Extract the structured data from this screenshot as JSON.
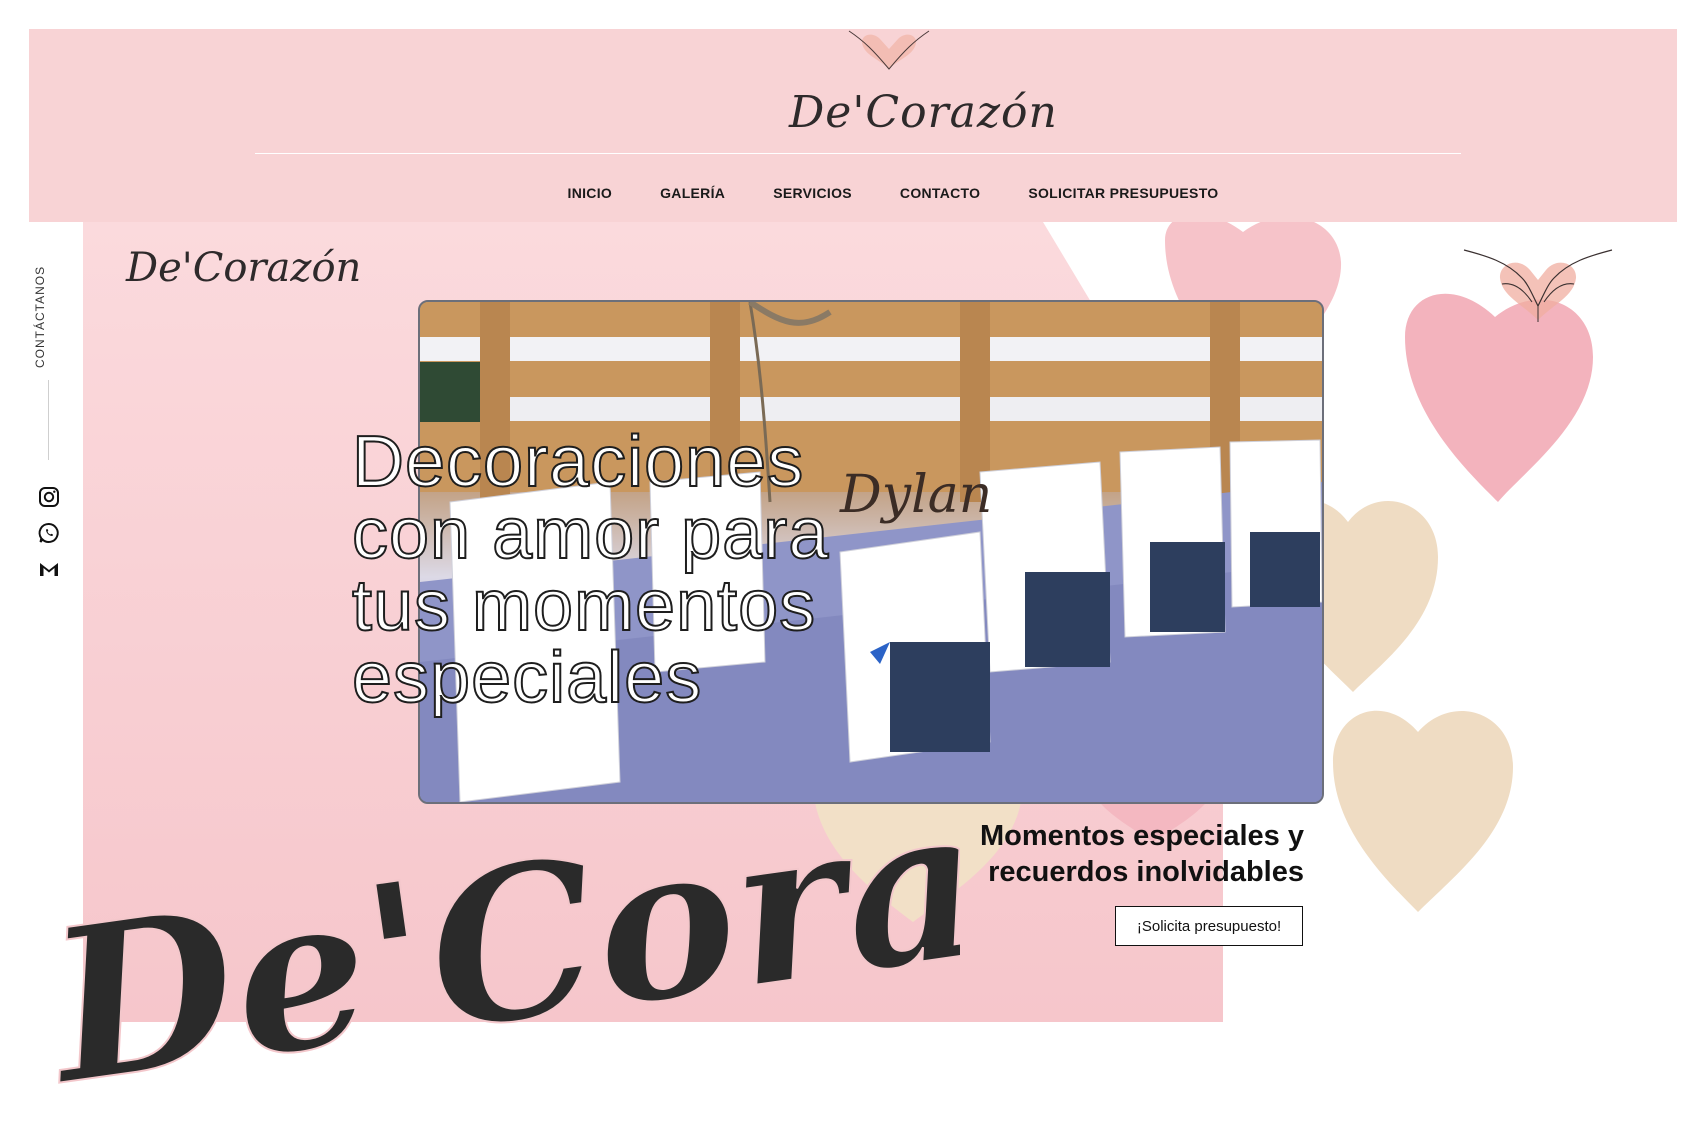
{
  "brand": {
    "logo_text": "De'Corazón",
    "colors": {
      "header_bg": "#f8d3d5",
      "hero_pink": "#f7cdd1",
      "accent_beige": "#efdcc3",
      "text_dark": "#1a1a1a"
    }
  },
  "nav": {
    "items": [
      {
        "label": "INICIO"
      },
      {
        "label": "GALERÍA"
      },
      {
        "label": "SERVICIOS"
      },
      {
        "label": "CONTACTO"
      },
      {
        "label": "SOLICITAR PRESUPUESTO"
      }
    ]
  },
  "sidebar": {
    "contact_label": "CONTÁCTANOS",
    "icons": [
      "instagram-icon",
      "whatsapp-icon",
      "gmail-icon"
    ]
  },
  "hero": {
    "headline": "Decoraciones con amor para tus momentos especiales",
    "video_caption_text": "Dylan",
    "tagline": "Momentos especiales y recuerdos inolvidables",
    "cta_label": "¡Solicita presupuesto!"
  }
}
